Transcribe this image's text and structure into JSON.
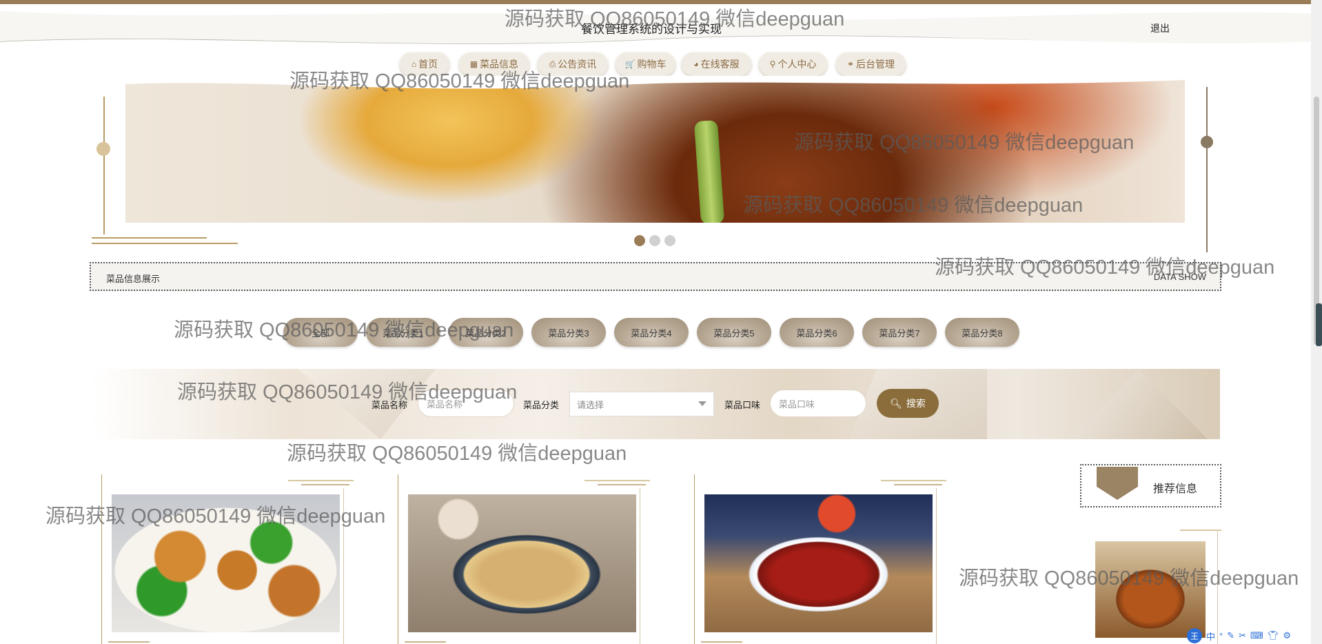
{
  "header": {
    "title": "餐饮管理系统的设计与实现",
    "logout_label": "退出"
  },
  "nav": {
    "items": [
      {
        "label": "首页",
        "icon": "home-icon",
        "glyph": "⌂"
      },
      {
        "label": "菜品信息",
        "icon": "grid-icon",
        "glyph": "▦"
      },
      {
        "label": "公告资讯",
        "icon": "notice-icon",
        "glyph": "⎙"
      },
      {
        "label": "购物车",
        "icon": "cart-icon",
        "glyph": "🛒"
      },
      {
        "label": "在线客服",
        "icon": "chat-icon",
        "glyph": "◕"
      },
      {
        "label": "个人中心",
        "icon": "user-icon",
        "glyph": "⚲"
      },
      {
        "label": "后台管理",
        "icon": "link-icon",
        "glyph": "⚭"
      }
    ]
  },
  "banner": {
    "slide_count": 3,
    "active_slide": 1
  },
  "section": {
    "title": "菜品信息展示",
    "subtitle": "DATA SHOW"
  },
  "categories": [
    "全部",
    "菜品分类1",
    "菜品分类2",
    "菜品分类3",
    "菜品分类4",
    "菜品分类5",
    "菜品分类6",
    "菜品分类7",
    "菜品分类8"
  ],
  "search": {
    "name_label": "菜品名称",
    "name_placeholder": "菜品名称",
    "category_label": "菜品分类",
    "category_value": "请选择",
    "taste_label": "菜品口味",
    "taste_placeholder": "菜品口味",
    "button_label": "搜索"
  },
  "recommend": {
    "title": "推荐信息"
  },
  "watermark": "源码获取 QQ86050149 微信deepguan",
  "ime": {
    "king": "王",
    "mode": "中"
  },
  "colors": {
    "accent": "#9a7c57",
    "search_button": "#8a6d3b"
  }
}
